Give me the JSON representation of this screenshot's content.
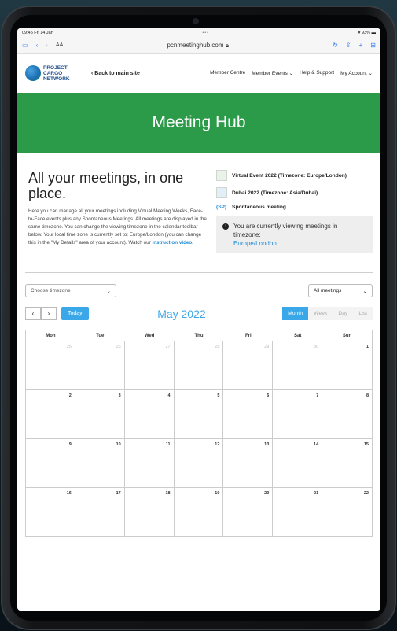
{
  "status_bar": {
    "time": "09:45",
    "date": "Fri 14 Jan",
    "dots": "•••",
    "battery": "93%"
  },
  "browser": {
    "aa": "AA",
    "url": "pcnmeetinghub.com"
  },
  "site": {
    "logo_lines": [
      "PROJECT",
      "CARGO",
      "NETWORK"
    ],
    "back_link": "Back to main site",
    "nav": [
      "Member Centre",
      "Member Events",
      "Help & Support",
      "My Account"
    ]
  },
  "hero": {
    "title": "Meeting Hub"
  },
  "intro": {
    "title": "All your meetings, in one place.",
    "body": "Here you can manage all your meetings including Virtual Meeting Weeks, Face-to-Face events plus any Spontaneous Meetings. All meetings are displayed in the same timezone. You can change the viewing timezone in the calendar toolbar below. Your local time zone is currently set to: Europe/London (you can change this in the \"My Details\" area of your account). Watch our",
    "link": "instruction video."
  },
  "legend": {
    "virtual": "Virtual Event 2022 (Timezone: Europe/London)",
    "dubai": "Dubai 2022 (Timezone: Asia/Dubai)",
    "sp_tag": "(SP)",
    "sp_label": "Spontaneous meeting"
  },
  "timezone_notice": {
    "text": "You are currently viewing meetings in timezone:",
    "zone": "Europe/London"
  },
  "controls": {
    "timezone_select": "Choose timezone",
    "meetings_select": "All meetings"
  },
  "toolbar": {
    "prev": "‹",
    "next": "›",
    "today": "Today",
    "title": "May 2022",
    "views": [
      "Month",
      "Week",
      "Day",
      "List"
    ],
    "active_view": "Month"
  },
  "calendar": {
    "weekdays": [
      "Mon",
      "Tue",
      "Wed",
      "Thu",
      "Fri",
      "Sat",
      "Sun"
    ],
    "weeks": [
      [
        {
          "d": "25",
          "m": true
        },
        {
          "d": "26",
          "m": true
        },
        {
          "d": "27",
          "m": true
        },
        {
          "d": "28",
          "m": true
        },
        {
          "d": "29",
          "m": true
        },
        {
          "d": "30",
          "m": true
        },
        {
          "d": "1",
          "m": false
        }
      ],
      [
        {
          "d": "2",
          "m": false
        },
        {
          "d": "3",
          "m": false
        },
        {
          "d": "4",
          "m": false
        },
        {
          "d": "5",
          "m": false
        },
        {
          "d": "6",
          "m": false
        },
        {
          "d": "7",
          "m": false
        },
        {
          "d": "8",
          "m": false
        }
      ],
      [
        {
          "d": "9",
          "m": false
        },
        {
          "d": "10",
          "m": false
        },
        {
          "d": "11",
          "m": false
        },
        {
          "d": "12",
          "m": false
        },
        {
          "d": "13",
          "m": false
        },
        {
          "d": "14",
          "m": false
        },
        {
          "d": "15",
          "m": false
        }
      ],
      [
        {
          "d": "16",
          "m": false
        },
        {
          "d": "17",
          "m": false
        },
        {
          "d": "18",
          "m": false
        },
        {
          "d": "19",
          "m": false
        },
        {
          "d": "20",
          "m": false
        },
        {
          "d": "21",
          "m": false
        },
        {
          "d": "22",
          "m": false
        }
      ]
    ]
  }
}
